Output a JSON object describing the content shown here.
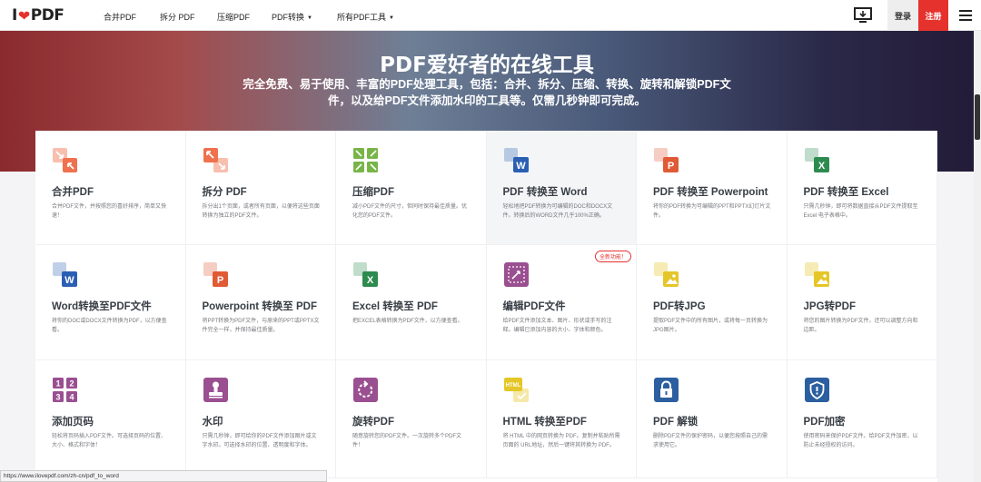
{
  "nav": {
    "logo": {
      "prefix": "I",
      "suffix": "PDF"
    },
    "links": [
      {
        "label": "合并PDF",
        "caret": false
      },
      {
        "label": "拆分 PDF",
        "caret": false
      },
      {
        "label": "压缩PDF",
        "caret": false
      },
      {
        "label": "PDF转换",
        "caret": true
      },
      {
        "label": "所有PDF工具",
        "caret": true
      }
    ],
    "login": "登录",
    "signup": "注册"
  },
  "hero": {
    "title": "PDF爱好者的在线工具",
    "subtitle": "完全免费、易于使用、丰富的PDF处理工具，包括：合并、拆分、压缩、转换、旋转和解锁PDF文件，以及给PDF文件添加水印的工具等。仅需几秒钟即可完成。"
  },
  "tools": [
    {
      "title": "合并PDF",
      "desc": "合并PDF文件，并按照您的喜好排序，简单又快速！",
      "icon": "merge-icon",
      "color": "#f0714d"
    },
    {
      "title": "拆分 PDF",
      "desc": "拆分出1个页面，或者所有页面，以便将这些页面转换为独立的PDF文件。",
      "icon": "split-icon",
      "color": "#f0714d"
    },
    {
      "title": "压缩PDF",
      "desc": "减小PDF文件的尺寸，但同时保持最佳质量。优化您的PDF文件。",
      "icon": "compress-icon",
      "color": "#78b548"
    },
    {
      "title": "PDF 转换至 Word",
      "desc": "轻松地把PDF转换为可编辑的DOC和DOCX文件。转换后的WORD文件几乎100%正确。",
      "icon": "word-icon",
      "color": "#2b5fb3",
      "active": true
    },
    {
      "title": "PDF 转换至 Powerpoint",
      "desc": "将你的PDF转换为可编辑的PPT和PPTX幻灯片文件。",
      "icon": "powerpoint-icon",
      "color": "#e05a35"
    },
    {
      "title": "PDF 转换至 Excel",
      "desc": "只需几秒钟，即可将数据直接从PDF文件提取至Excel 电子表格中。",
      "icon": "excel-icon",
      "color": "#2e8b4f"
    },
    {
      "title": "Word转换至PDF文件",
      "desc": "将你的DOC或DOCX文件转换为PDF，以方便查看。",
      "icon": "word-icon",
      "color": "#2b5fb3"
    },
    {
      "title": "Powerpoint 转换至 PDF",
      "desc": "将PPT转换为PDF文件，与原来的PPT或PPTX文件完全一样，并保持最佳质量。",
      "icon": "powerpoint-icon",
      "color": "#e05a35"
    },
    {
      "title": "Excel 转换至 PDF",
      "desc": "把EXCEL表格转换为PDF文件，以方便查看。",
      "icon": "excel-icon",
      "color": "#2e8b4f"
    },
    {
      "title": "编辑PDF文件",
      "desc": "给PDF文件添加文本、图片、形状或手写的注释。编辑已添加内容的大小、字体和颜色。",
      "icon": "edit-icon",
      "color": "#9a4f91",
      "badge": "全新功能！"
    },
    {
      "title": "PDF转JPG",
      "desc": "提取PDF文件中的所有图片，或将每一页转换为JPG图片。",
      "icon": "jpg-icon",
      "color": "#e5c628"
    },
    {
      "title": "JPG转PDF",
      "desc": "将您的图片转换为PDF文件，还可以调整方向和边距。",
      "icon": "jpg-icon",
      "color": "#e5c628"
    },
    {
      "title": "添加页码",
      "desc": "轻松将页码插入PDF文件。可选择页码的位置、大小、格式和字体！",
      "icon": "page-numbers-icon",
      "color": "#9a4f91"
    },
    {
      "title": "水印",
      "desc": "只需几秒钟，即可给你的PDF文件添加图片或文字水印。可选择水印的位置、透明度和字体。",
      "icon": "stamp-icon",
      "color": "#9a4f91"
    },
    {
      "title": "旋转PDF",
      "desc": "随意旋转您的PDF文件。一次旋转多个PDF文件！",
      "icon": "rotate-icon",
      "color": "#9a4f91"
    },
    {
      "title": "HTML 转换至PDF",
      "desc": "将 HTML 中的网页转换为 PDF。复制并粘贴所需页面的 URL地址，然后一键将其转换为 PDF。",
      "icon": "html-icon",
      "color": "#e5c628"
    },
    {
      "title": "PDF 解锁",
      "desc": "删除PDF文件的保护密码，以便您按照自己的需求使用它。",
      "icon": "unlock-icon",
      "color": "#2b5fa0"
    },
    {
      "title": "PDF加密",
      "desc": "使用密码来保护PDF文件。给PDF文件加密，以防止未经授权的访问。",
      "icon": "protect-icon",
      "color": "#2b5fa0"
    }
  ],
  "status_url": "https://www.ilovepdf.com/zh-cn/pdf_to_word"
}
